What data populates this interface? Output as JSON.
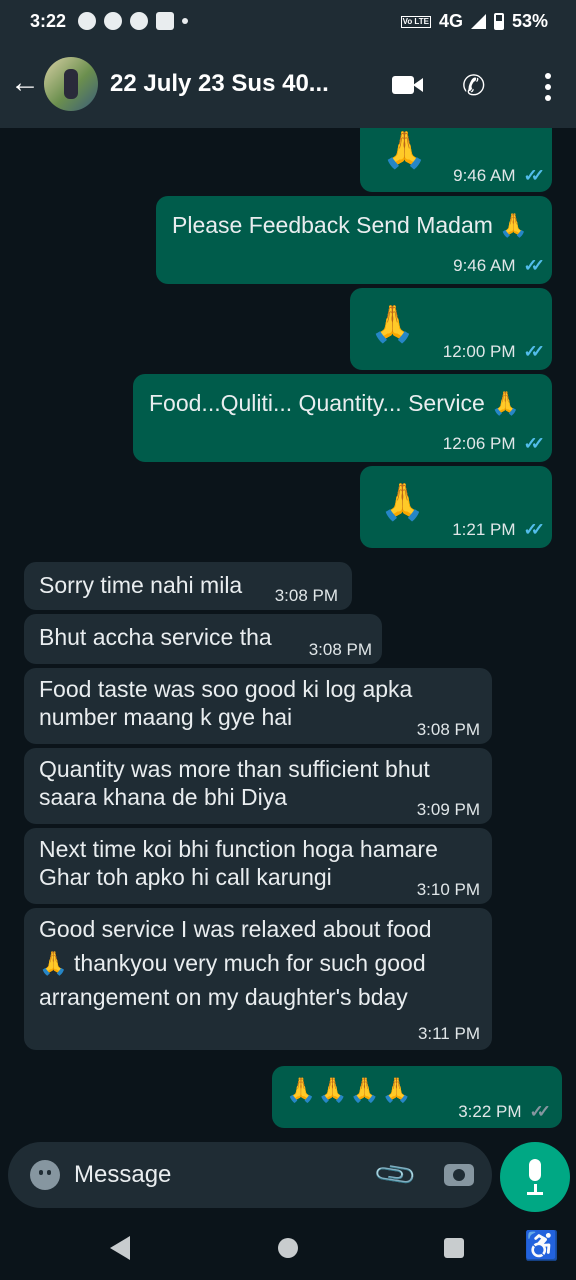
{
  "status_bar": {
    "time": "3:22",
    "network": "4G",
    "volte": "Vo LTE",
    "battery": "53%"
  },
  "header": {
    "title": "22 July 23 Sus 40...",
    "back_icon": "arrow-left-icon",
    "video_icon": "video-camera-icon",
    "call_icon": "phone-icon",
    "menu_icon": "more-vertical-icon"
  },
  "messages": [
    {
      "dir": "out",
      "text": "🙏",
      "time": "9:46 AM",
      "read": true
    },
    {
      "dir": "out",
      "text": "Please Feedback Send Madam 🙏",
      "time": "9:46 AM",
      "read": true
    },
    {
      "dir": "out",
      "text": "🙏",
      "time": "12:00 PM",
      "read": true
    },
    {
      "dir": "out",
      "text": "Food...Quliti... Quantity... Service 🙏",
      "time": "12:06 PM",
      "read": true
    },
    {
      "dir": "out",
      "text": "🙏",
      "time": "1:21 PM",
      "read": true
    },
    {
      "dir": "in",
      "text": "Sorry time nahi mila",
      "time": "3:08 PM"
    },
    {
      "dir": "in",
      "text": "Bhut accha service tha",
      "time": "3:08 PM"
    },
    {
      "dir": "in",
      "line1": "Food taste was soo good ki log apka",
      "line2": "number maang k gye hai",
      "time": "3:08 PM"
    },
    {
      "dir": "in",
      "line1": "Quantity was more than sufficient bhut",
      "line2": "saara khana de bhi Diya",
      "time": "3:09 PM"
    },
    {
      "dir": "in",
      "line1": "Next time koi bhi function hoga hamare",
      "line2": "Ghar toh apko hi call karungi",
      "time": "3:10 PM"
    },
    {
      "dir": "in",
      "line1": "Good service I was relaxed about food",
      "line2": "🙏 thankyou very much for such good",
      "line3": "arrangement on my daughter's bday",
      "time": "3:11 PM"
    },
    {
      "dir": "out",
      "text": "🙏🙏🙏🙏",
      "time": "3:22 PM",
      "read": false
    }
  ],
  "input": {
    "placeholder": "Message",
    "emoji_icon": "emoji-icon",
    "attach_icon": "paperclip-icon",
    "camera_icon": "camera-icon",
    "mic_icon": "microphone-icon"
  },
  "colors": {
    "outgoing_bubble": "#005c4b",
    "incoming_bubble": "#1f2c34",
    "background": "#0b141a",
    "read_ticks": "#53bdeb",
    "accent": "#00a884"
  }
}
